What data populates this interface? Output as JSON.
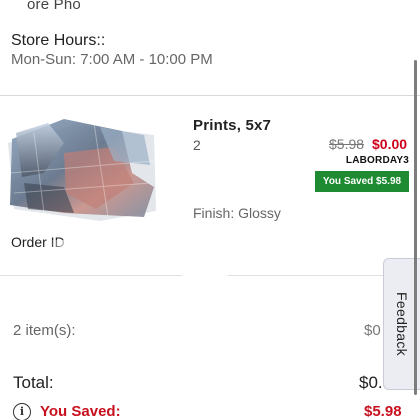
{
  "store": {
    "name_partial": "ore Pho",
    "hours_title": "Store Hours::",
    "hours_value": "Mon-Sun: 7:00 AM - 10:00 PM"
  },
  "item": {
    "name": "Prints, 5x7",
    "quantity": "2",
    "price_original": "$5.98",
    "price_final": "$0.00",
    "promo_code": "LABORDAY3",
    "saved_badge": "You Saved $5.98",
    "finish": "Finish: Glossy"
  },
  "order": {
    "id_label": "Order ID"
  },
  "summary": {
    "items_label": "2 item(s):",
    "items_value": "$0",
    "total_label": "Total:",
    "total_value": "$0.",
    "saved_label": "You Saved:",
    "saved_value": "$5.98",
    "info_glyph": "i"
  },
  "feedback": {
    "label": "Feedback"
  },
  "colors": {
    "discount_red": "#d0021b",
    "saved_green": "#1e8a32"
  }
}
